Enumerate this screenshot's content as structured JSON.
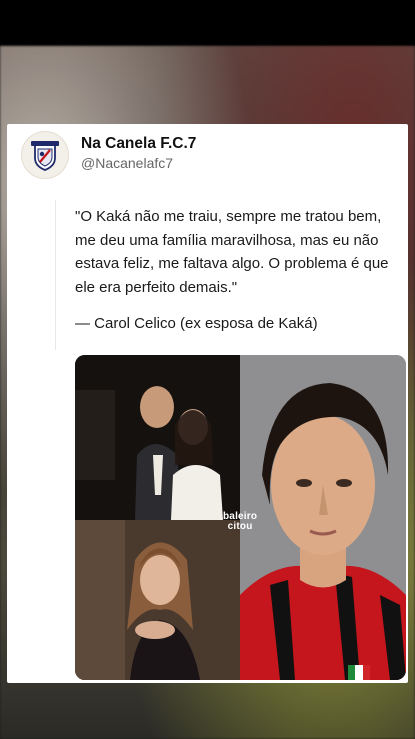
{
  "account": {
    "display_name": "Na Canela F.C.7",
    "handle": "@Nacanelafc7"
  },
  "tweet": {
    "quote": "\"O Kaká não me traiu, sempre me tratou bem, me deu uma família maravilhosa, mas eu não estava feliz, me faltava algo. O problema é que ele era perfeito demais.\"",
    "attribution": "— Carol Celico (ex esposa de Kaká)"
  },
  "media": {
    "watermark_line1": "baleiro",
    "watermark_line2": "citou"
  },
  "colors": {
    "card_bg": "#ffffff",
    "text_primary": "#111111",
    "text_secondary": "#666666",
    "milan_red": "#c4161c"
  }
}
